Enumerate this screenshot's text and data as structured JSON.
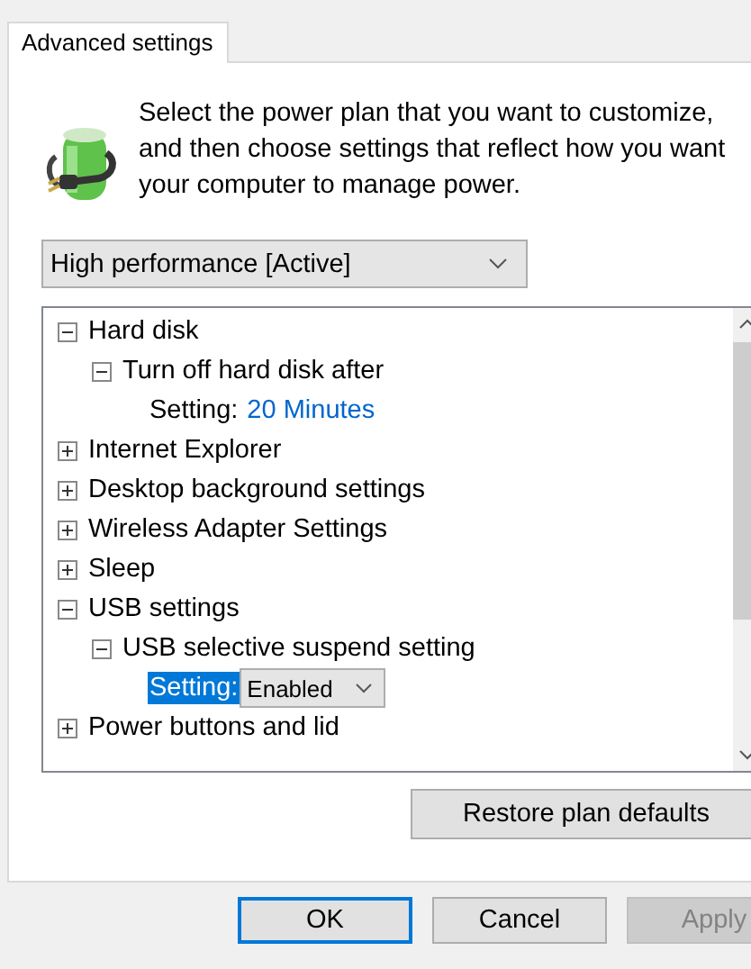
{
  "tabs": [
    {
      "label": "Advanced settings",
      "selected": true
    }
  ],
  "description": "Select the power plan that you want to customize, and then choose settings that reflect how you want your computer to manage power.",
  "plan_select": {
    "value": "High performance [Active]"
  },
  "tree": [
    {
      "kind": "group",
      "label": "Hard disk",
      "expanded": true,
      "children": [
        {
          "kind": "group",
          "label": "Turn off hard disk after",
          "expanded": true,
          "children": [
            {
              "kind": "value",
              "label": "Setting:",
              "value": "20 Minutes",
              "selected": false
            }
          ]
        }
      ]
    },
    {
      "kind": "group",
      "label": "Internet Explorer",
      "expanded": false
    },
    {
      "kind": "group",
      "label": "Desktop background settings",
      "expanded": false
    },
    {
      "kind": "group",
      "label": "Wireless Adapter Settings",
      "expanded": false
    },
    {
      "kind": "group",
      "label": "Sleep",
      "expanded": false
    },
    {
      "kind": "group",
      "label": "USB settings",
      "expanded": true,
      "children": [
        {
          "kind": "group",
          "label": "USB selective suspend setting",
          "expanded": true,
          "children": [
            {
              "kind": "dropdown",
              "label": "Setting:",
              "value": "Enabled",
              "selected": true
            }
          ]
        }
      ]
    },
    {
      "kind": "group",
      "label": "Power buttons and lid",
      "expanded": false
    }
  ],
  "restore_button": "Restore plan defaults",
  "buttons": [
    {
      "label": "OK",
      "kind": "default",
      "disabled": false
    },
    {
      "label": "Cancel",
      "kind": "normal",
      "disabled": false
    },
    {
      "label": "Apply",
      "kind": "normal",
      "disabled": true
    }
  ]
}
